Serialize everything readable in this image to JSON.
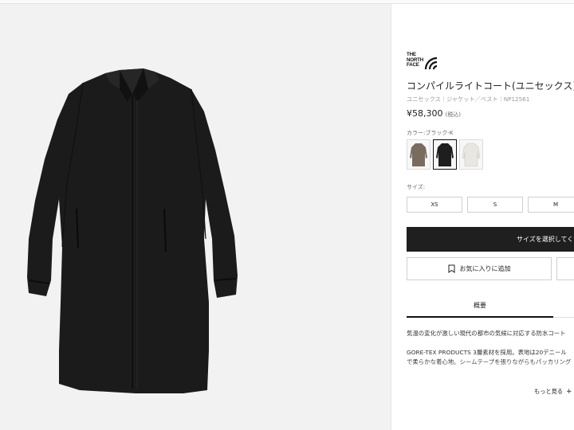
{
  "brand": {
    "logo_alt": "THE NORTH FACE",
    "logo_lines": [
      "THE",
      "NORTH",
      "FACE"
    ]
  },
  "product": {
    "title": "コンパイルライトコート(ユニセックス)",
    "breadcrumb": "ユニセックス｜ジャケット／ベスト｜NP12561",
    "price": "¥58,300",
    "tax_note": "(税込)"
  },
  "color": {
    "label": "カラー:ブラック-K",
    "swatches": [
      {
        "name": "brown",
        "hex": "#7a6b5f",
        "selected": false
      },
      {
        "name": "black",
        "hex": "#1e1e1e",
        "selected": true
      },
      {
        "name": "white",
        "hex": "#e9e7e2",
        "selected": false
      }
    ]
  },
  "size": {
    "label": "サイズ:",
    "options": [
      "XS",
      "S",
      "M"
    ]
  },
  "actions": {
    "select_size": "サイズを選択してください",
    "favorite": "お気に入りに追加"
  },
  "tabs": {
    "overview": "概要"
  },
  "description": {
    "line1": "気温の変化が激しい現代の都市の気候に対応する防水コート",
    "line2": "GORE-TEX PRODUCTS 3層素材を採用。表地は20デニール",
    "line3": "で柔らかな着心地。シームテープを張りながらもパッカリング"
  },
  "more": {
    "label": "もっと見る",
    "icon": "+"
  }
}
